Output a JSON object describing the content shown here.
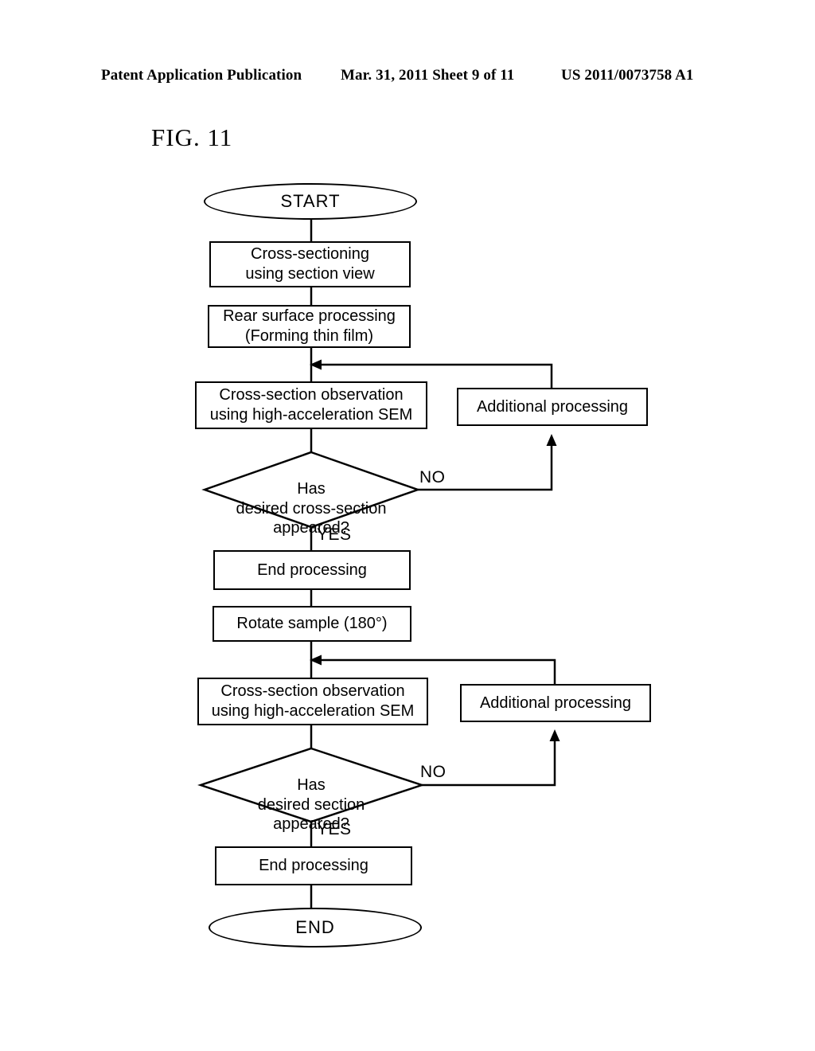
{
  "header": {
    "left": "Patent Application Publication",
    "middle": "Mar. 31, 2011  Sheet 9 of 11",
    "right": "US 2011/0073758 A1"
  },
  "figure": {
    "title": "FIG. 11"
  },
  "flowchart": {
    "nodes": [
      {
        "id": "start",
        "type": "terminator",
        "label": "START"
      },
      {
        "id": "cross_sect",
        "type": "process",
        "label": "Cross-sectioning\nusing section view"
      },
      {
        "id": "rear_surface",
        "type": "process",
        "label": "Rear surface processing\n(Forming thin film)"
      },
      {
        "id": "observe1",
        "type": "process",
        "label": "Cross-section observation\nusing high-acceleration SEM"
      },
      {
        "id": "additional1",
        "type": "process",
        "label": "Additional processing"
      },
      {
        "id": "decision1",
        "type": "decision",
        "label": "Has\ndesired cross-section\nappeared?"
      },
      {
        "id": "end_proc1",
        "type": "process",
        "label": "End processing"
      },
      {
        "id": "rotate",
        "type": "process",
        "label": "Rotate sample (180°)"
      },
      {
        "id": "observe2",
        "type": "process",
        "label": "Cross-section observation\nusing high-acceleration SEM"
      },
      {
        "id": "additional2",
        "type": "process",
        "label": "Additional processing"
      },
      {
        "id": "decision2",
        "type": "decision",
        "label": "Has\ndesired section\nappeared?"
      },
      {
        "id": "end_proc2",
        "type": "process",
        "label": "End processing"
      },
      {
        "id": "end",
        "type": "terminator",
        "label": "END"
      }
    ],
    "edge_labels": {
      "decision1_no": "NO",
      "decision1_yes": "YES",
      "decision2_no": "NO",
      "decision2_yes": "YES"
    }
  }
}
